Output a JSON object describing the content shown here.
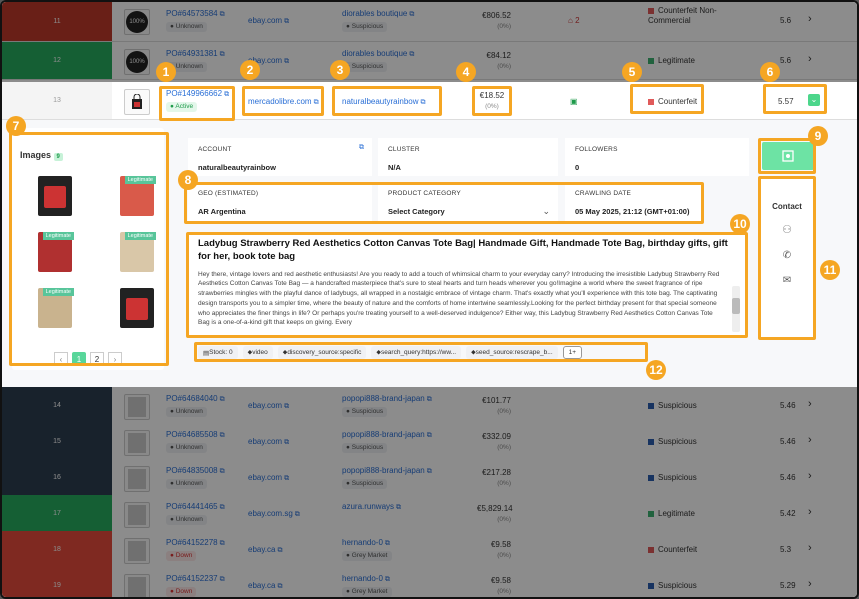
{
  "rows_top": [
    {
      "idx": "11",
      "color": "#c0392b",
      "po": "PO#64573584",
      "marketplace": "ebay.com",
      "seller": "diorables boutique",
      "status": "Unknown",
      "seller_status": "Suspicious",
      "price": "€806.52",
      "price_pct": "(0%)",
      "count": "2",
      "verdict": "Counterfeit Non-Commercial",
      "verdict_color": "#e05a5a",
      "score": "5.6",
      "thumb": "100%"
    },
    {
      "idx": "12",
      "color": "#27ae60",
      "po": "PO#64931381",
      "marketplace": "ebay.com",
      "seller": "diorables boutique",
      "status": "Unknown",
      "seller_status": "Suspicious",
      "price": "€84.12",
      "price_pct": "(0%)",
      "count": "",
      "verdict": "Legitimate",
      "verdict_color": "#3cb371",
      "score": "5.6",
      "thumb": "100%"
    }
  ],
  "active_row": {
    "idx": "13",
    "po": "PO#149966662",
    "status": "Active",
    "marketplace": "mercadolibre.com",
    "seller": "naturalbeautyrainbow",
    "price": "€18.52",
    "price_pct": "(0%)",
    "verdict": "Counterfeit",
    "verdict_color": "#e05a5a",
    "score": "5.57"
  },
  "detail": {
    "images_title": "Images",
    "images_count": "9",
    "legit_label": "Legitimate",
    "pages": [
      "1",
      "2"
    ],
    "account_label": "ACCOUNT",
    "account_value": "naturalbeautyrainbow",
    "cluster_label": "CLUSTER",
    "cluster_value": "N/A",
    "followers_label": "FOLLOWERS",
    "followers_value": "0",
    "geo_label": "GEO (ESTIMATED)",
    "geo_code": "AR",
    "geo_value": "Argentina",
    "category_label": "PRODUCT CATEGORY",
    "category_value": "Select Category",
    "crawl_label": "CRAWLING DATE",
    "crawl_value": "05 May 2025, 21:12 (GMT+01:00)",
    "title": "Ladybug Strawberry Red Aesthetics Cotton Canvas Tote Bag| Handmade Gift, Handmade Tote Bag, birthday gifts, gift for her, book tote bag",
    "description": "Hey there, vintage lovers and red aesthetic enthusiasts! Are you ready to add a touch of whimsical charm to your everyday carry? Introducing the irresistible Ladybug Strawberry Red Aesthetics Cotton Canvas Tote Bag — a handcrafted masterpiece that's sure to steal hearts and turn heads wherever you go!Imagine a world where the sweet fragrance of ripe strawberries mingles with the playful dance of ladybugs, all wrapped in a nostalgic embrace of vintage charm. That's exactly what you'll experience with this tote bag. The captivating design transports you to a simpler time, where the beauty of nature and the comforts of home intertwine seamlessly.Looking for the perfect birthday present for that special someone who appreciates the finer things in life? Or perhaps you're treating yourself to a well-deserved indulgence? Either way, this Ladybug Strawberry Red Aesthetics Cotton Canvas Tote Bag is a one-of-a-kind gift that keeps on giving. Every",
    "tags": [
      "Stock: 0",
      "video",
      "discovery_source:specific",
      "search_query:https://ww...",
      "seed_source:rescrape_b..."
    ],
    "tags_more": "1+",
    "contact_title": "Contact"
  },
  "rows_bottom": [
    {
      "idx": "14",
      "color": "#2c3e50",
      "po": "PO#64684040",
      "marketplace": "ebay.com",
      "seller": "popopi888-brand-japan",
      "status": "Unknown",
      "seller_status": "Suspicious",
      "price": "€101.77",
      "price_pct": "(0%)",
      "verdict": "Suspicious",
      "verdict_color": "#2a5db0",
      "score": "5.46"
    },
    {
      "idx": "15",
      "color": "#2c3e50",
      "po": "PO#64685508",
      "marketplace": "ebay.com",
      "seller": "popopi888-brand-japan",
      "status": "Unknown",
      "seller_status": "Suspicious",
      "price": "€332.09",
      "price_pct": "(0%)",
      "verdict": "Suspicious",
      "verdict_color": "#2a5db0",
      "score": "5.46"
    },
    {
      "idx": "16",
      "color": "#2c3e50",
      "po": "PO#64835008",
      "marketplace": "ebay.com",
      "seller": "popopi888-brand-japan",
      "status": "Unknown",
      "seller_status": "Suspicious",
      "price": "€217.28",
      "price_pct": "(0%)",
      "verdict": "Suspicious",
      "verdict_color": "#2a5db0",
      "score": "5.46"
    },
    {
      "idx": "17",
      "color": "#27ae60",
      "po": "PO#64441465",
      "marketplace": "ebay.com.sg",
      "seller": "azura.runways",
      "status": "Unknown",
      "seller_status": "",
      "price": "€5,829.14",
      "price_pct": "(0%)",
      "verdict": "Legitimate",
      "verdict_color": "#3cb371",
      "score": "5.42"
    },
    {
      "idx": "18",
      "color": "#e74c3c",
      "po": "PO#64152278",
      "marketplace": "ebay.ca",
      "seller": "hernando-0",
      "status": "Down",
      "seller_status": "Grey Market",
      "price": "€9.58",
      "price_pct": "(0%)",
      "verdict": "Counterfeit",
      "verdict_color": "#e05a5a",
      "score": "5.3"
    },
    {
      "idx": "19",
      "color": "#e74c3c",
      "po": "PO#64152237",
      "marketplace": "ebay.ca",
      "seller": "hernando-0",
      "status": "Down",
      "seller_status": "Grey Market",
      "price": "€9.58",
      "price_pct": "(0%)",
      "verdict": "Suspicious",
      "verdict_color": "#2a5db0",
      "score": "5.29"
    }
  ],
  "callouts": [
    "1",
    "2",
    "3",
    "4",
    "5",
    "6",
    "7",
    "8",
    "9",
    "10",
    "11",
    "12"
  ]
}
